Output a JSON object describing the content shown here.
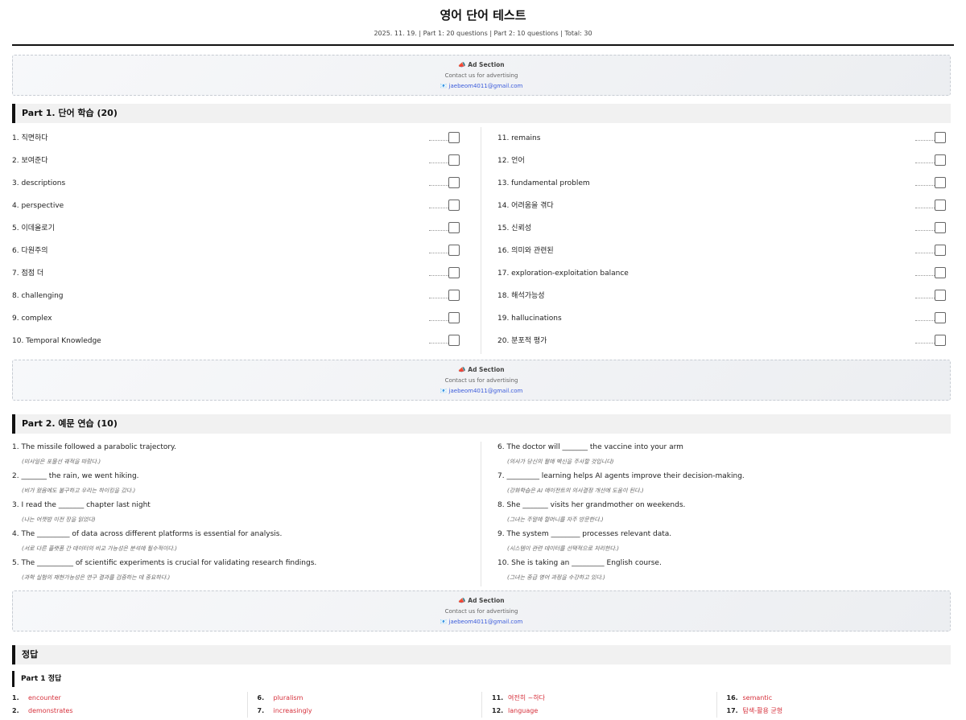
{
  "header": {
    "title": "영어 단어 테스트",
    "meta": "2025. 11. 19. | Part 1: 20 questions | Part 2: 10 questions | Total: 30"
  },
  "ad": {
    "title": "📣 Ad Section",
    "subtitle": "Contact us for advertising",
    "email": "📧 jaebeom4011@gmail.com"
  },
  "part1": {
    "title": "Part 1. 단어 학습 (20)",
    "left": [
      "1. 직면하다",
      "2. 보여준다",
      "3. descriptions",
      "4. perspective",
      "5. 이데올로기",
      "6. 다원주의",
      "7. 점점 더",
      "8. challenging",
      "9. complex",
      "10. Temporal Knowledge"
    ],
    "right": [
      "11. remains",
      "12. 언어",
      "13. fundamental problem",
      "14. 어려움을 겪다",
      "15. 신뢰성",
      "16. 의미와 관련된",
      "17. exploration-exploitation balance",
      "18. 해석가능성",
      "19. hallucinations",
      "20. 분포적 평가"
    ]
  },
  "part2": {
    "title": "Part 2. 예문 연습 (10)",
    "left": [
      {
        "q": "1. The missile followed a parabolic trajectory.",
        "t": "(미사일은 포물선 궤적을 따랐다.)"
      },
      {
        "q": "2. _______ the rain, we went hiking.",
        "t": "(비가 왔음에도 불구하고 우리는 하이킹을 갔다.)"
      },
      {
        "q": "3. I read the _______ chapter last night",
        "t": "(나는 어젯밤 이전 장을 읽었다)"
      },
      {
        "q": "4. The _________ of data across different platforms is essential for analysis.",
        "t": "(서로 다른 플랫폼 간 데이터의 비교 가능성은 분석에 필수적이다.)"
      },
      {
        "q": "5. The __________ of scientific experiments is crucial for validating research findings.",
        "t": "(과학 실험의 재현가능성은 연구 결과를 검증하는 데 중요하다.)"
      }
    ],
    "right": [
      {
        "q": "6. The doctor will _______ the vaccine into your arm",
        "t": "(의사가 당신의 팔에 백신을 주사할 것입니다)"
      },
      {
        "q": "7. _________ learning helps AI agents improve their decision-making.",
        "t": "(강화학습은 AI 에이전트의 의사결정 개선에 도움이 된다.)"
      },
      {
        "q": "8. She _______ visits her grandmother on weekends.",
        "t": "(그녀는 주말에 할머니를 자주 방문한다.)"
      },
      {
        "q": "9. The system ________ processes relevant data.",
        "t": "(시스템이 관련 데이터를 선택적으로 처리한다.)"
      },
      {
        "q": "10. She is taking an _________ English course.",
        "t": "(그녀는 중급 영어 과정을 수강하고 있다.)"
      }
    ]
  },
  "answers": {
    "title": "정답",
    "part1_title": "Part 1 정답",
    "cols": [
      [
        {
          "n": "1.",
          "a": "encounter"
        },
        {
          "n": "2.",
          "a": "demonstrates"
        }
      ],
      [
        {
          "n": "6.",
          "a": "pluralism"
        },
        {
          "n": "7.",
          "a": "increasingly"
        }
      ],
      [
        {
          "n": "11.",
          "a": "여전히 ~하다"
        },
        {
          "n": "12.",
          "a": "language"
        }
      ],
      [
        {
          "n": "16.",
          "a": "semantic"
        },
        {
          "n": "17.",
          "a": "탐색-활용 균형"
        }
      ]
    ]
  }
}
